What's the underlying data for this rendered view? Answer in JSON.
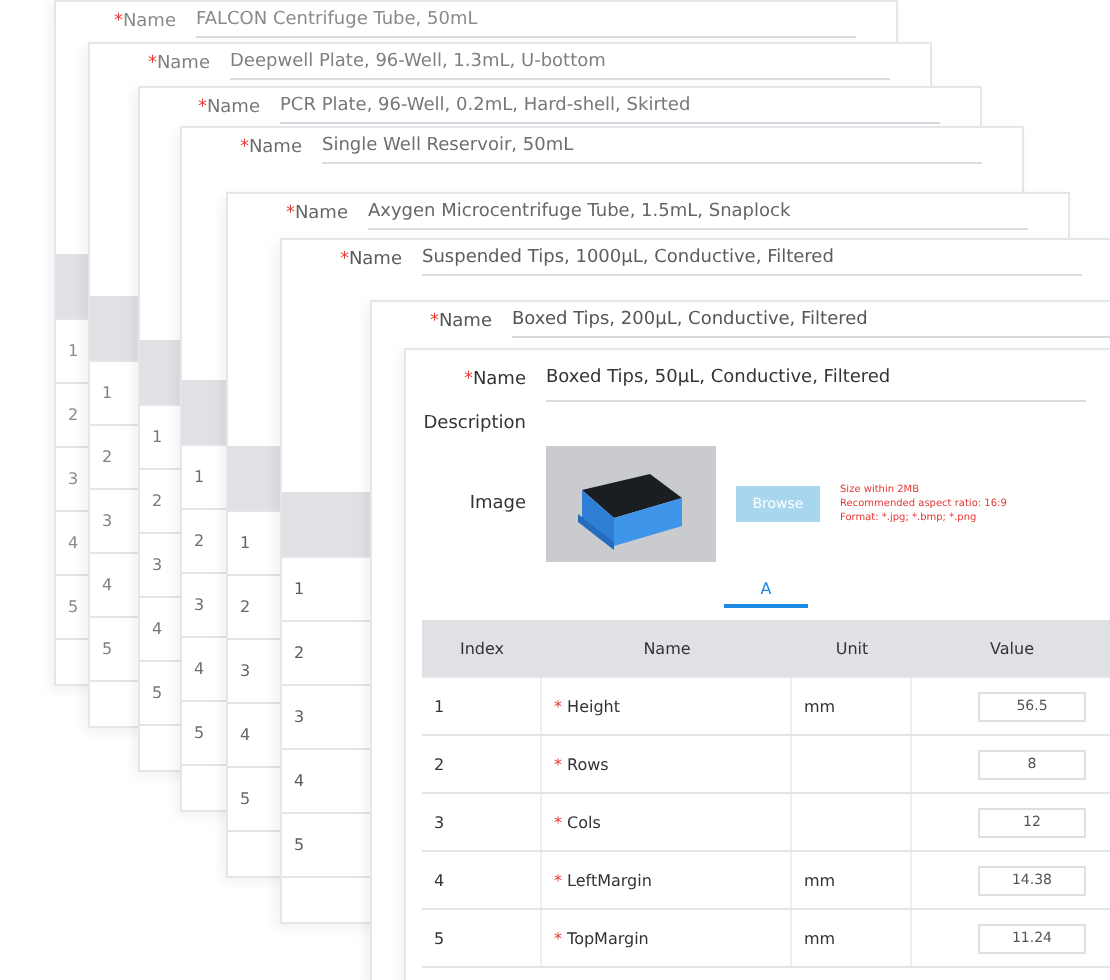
{
  "cards": [
    {
      "required_mark": "*",
      "name_label": "Name",
      "name": "FALCON Centrifuge Tube, 50mL",
      "indices": [
        "1",
        "2",
        "3",
        "4",
        "5"
      ]
    },
    {
      "required_mark": "*",
      "name_label": "Name",
      "name": "Deepwell Plate, 96-Well, 1.3mL, U-bottom",
      "indices": [
        "1",
        "2",
        "3",
        "4",
        "5"
      ]
    },
    {
      "required_mark": "*",
      "name_label": "Name",
      "name": "PCR Plate, 96-Well, 0.2mL, Hard-shell, Skirted",
      "indices": [
        "1",
        "2",
        "3",
        "4",
        "5"
      ]
    },
    {
      "required_mark": "*",
      "name_label": "Name",
      "name": "Single Well Reservoir, 50mL",
      "indices": [
        "1",
        "2",
        "3",
        "4",
        "5"
      ]
    },
    {
      "required_mark": "*",
      "name_label": "Name",
      "name": "Axygen Microcentrifuge Tube, 1.5mL, Snaplock",
      "indices": [
        "1",
        "2",
        "3",
        "4",
        "5"
      ]
    },
    {
      "required_mark": "*",
      "name_label": "Name",
      "name": "Suspended Tips, 1000µL, Conductive, Filtered",
      "indices": [
        "1",
        "2",
        "3",
        "4",
        "5"
      ]
    },
    {
      "required_mark": "*",
      "name_label": "Name",
      "name": "Boxed Tips, 200µL, Conductive, Filtered"
    }
  ],
  "front": {
    "required_mark": "*",
    "name_label": "Name",
    "name": "Boxed Tips, 50µL, Conductive, Filtered",
    "description_label": "Description",
    "image_label": "Image",
    "browse": {
      "label": "Browse",
      "disabled": true
    },
    "hints": [
      "Size within 2MB",
      "Recommended aspect ratio: 16:9",
      "Format: *.jpg; *.bmp; *.png"
    ],
    "tabs": [
      {
        "label": "A",
        "selected": true
      }
    ],
    "columns": [
      "Index",
      "Name",
      "Unit",
      "Value"
    ],
    "rows": [
      {
        "index": "1",
        "required_mark": "*",
        "name": "Height",
        "unit": "mm",
        "value": "56.5"
      },
      {
        "index": "2",
        "required_mark": "*",
        "name": "Rows",
        "value": "8"
      },
      {
        "index": "3",
        "required_mark": "*",
        "name": "Cols",
        "value": "12"
      },
      {
        "index": "4",
        "required_mark": "*",
        "name": "LeftMargin",
        "unit": "mm",
        "value": "14.38"
      },
      {
        "index": "5",
        "required_mark": "*",
        "name": "TopMargin",
        "unit": "mm",
        "value": "11.24"
      }
    ]
  }
}
